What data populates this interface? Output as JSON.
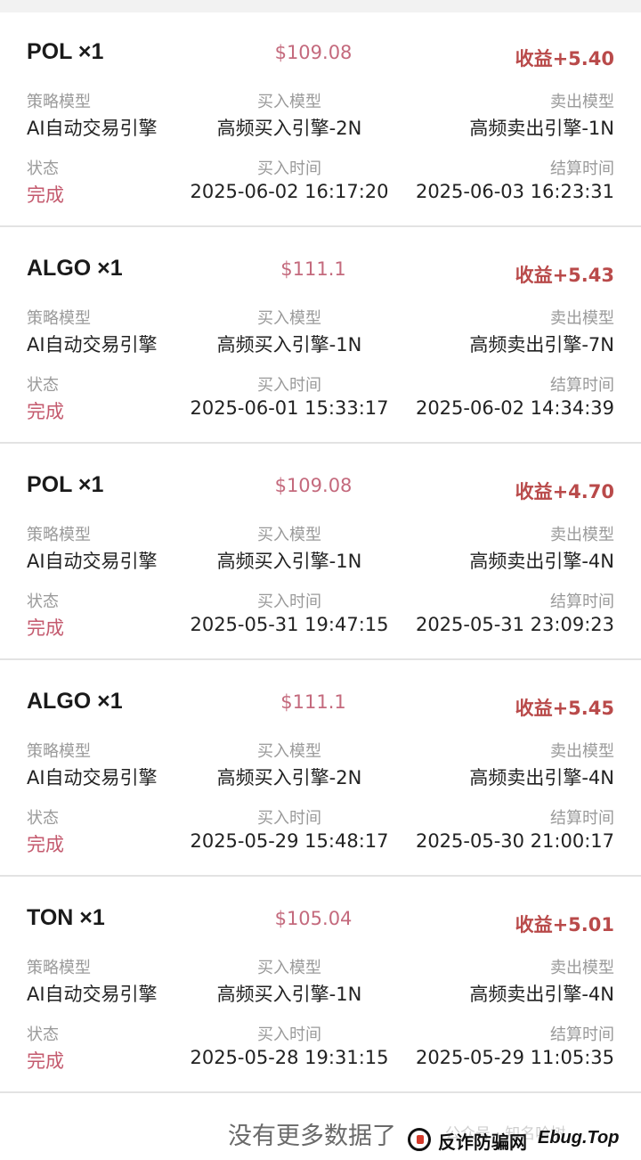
{
  "labels": {
    "strategy_model": "策略模型",
    "buy_model": "买入模型",
    "sell_model": "卖出模型",
    "status": "状态",
    "buy_time": "买入时间",
    "settle_time": "结算时间"
  },
  "orders": [
    {
      "symbol": "POL ×1",
      "price": "$109.08",
      "profit": "收益+5.40",
      "strategy_model": "AI自动交易引擎",
      "buy_model": "高频买入引擎-2N",
      "sell_model": "高频卖出引擎-1N",
      "status": "完成",
      "buy_time": "2025-06-02 16:17:20",
      "settle_time": "2025-06-03 16:23:31"
    },
    {
      "symbol": "ALGO ×1",
      "price": "$111.1",
      "profit": "收益+5.43",
      "strategy_model": "AI自动交易引擎",
      "buy_model": "高频买入引擎-1N",
      "sell_model": "高频卖出引擎-7N",
      "status": "完成",
      "buy_time": "2025-06-01 15:33:17",
      "settle_time": "2025-06-02 14:34:39"
    },
    {
      "symbol": "POL ×1",
      "price": "$109.08",
      "profit": "收益+4.70",
      "strategy_model": "AI自动交易引擎",
      "buy_model": "高频买入引擎-1N",
      "sell_model": "高频卖出引擎-4N",
      "status": "完成",
      "buy_time": "2025-05-31 19:47:15",
      "settle_time": "2025-05-31 23:09:23"
    },
    {
      "symbol": "ALGO ×1",
      "price": "$111.1",
      "profit": "收益+5.45",
      "strategy_model": "AI自动交易引擎",
      "buy_model": "高频买入引擎-2N",
      "sell_model": "高频卖出引擎-4N",
      "status": "完成",
      "buy_time": "2025-05-29 15:48:17",
      "settle_time": "2025-05-30 21:00:17"
    },
    {
      "symbol": "TON ×1",
      "price": "$105.04",
      "profit": "收益+5.01",
      "strategy_model": "AI自动交易引擎",
      "buy_model": "高频买入引擎-1N",
      "sell_model": "高频卖出引擎-4N",
      "status": "完成",
      "buy_time": "2025-05-28 19:31:15",
      "settle_time": "2025-05-29 11:05:35"
    }
  ],
  "footer": {
    "no_more": "没有更多数据了"
  },
  "watermark": {
    "faint_text": "公众号 · 知名哈树",
    "site_name": "反诈防骗网",
    "site_url": "Ebug.Top"
  },
  "colors": {
    "price": "#c46a7d",
    "profit": "#b94a4a",
    "status_done": "#c45a6e",
    "label": "#9a9a9a"
  }
}
